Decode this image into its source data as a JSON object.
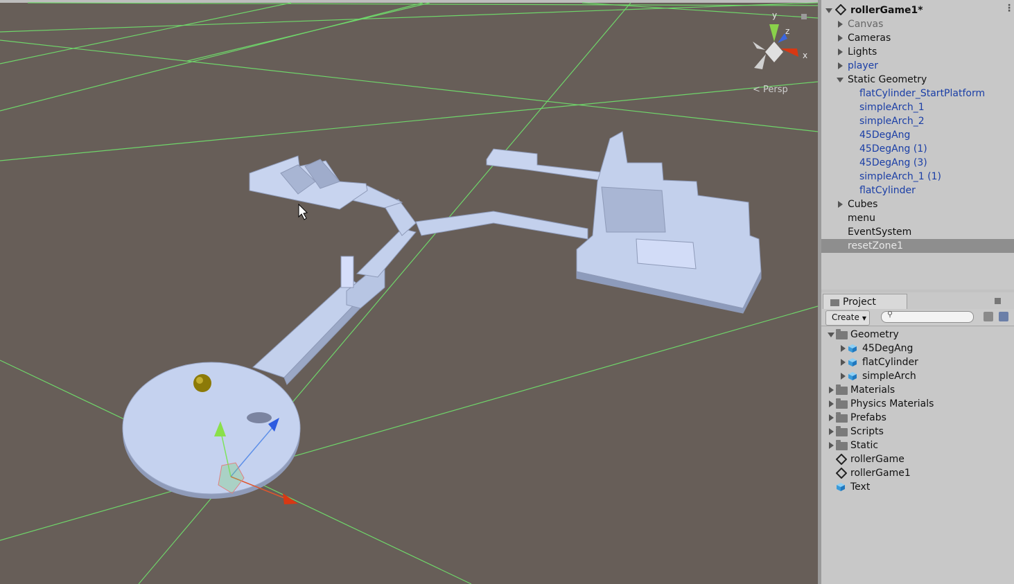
{
  "scene": {
    "persp_label": "Persp",
    "gizmo_axis_labels": {
      "x": "x",
      "y": "y",
      "z": "z"
    }
  },
  "hierarchy": {
    "scene_name": "rollerGame1*",
    "items": [
      {
        "label": "Canvas",
        "style": "grey"
      },
      {
        "label": "Cameras",
        "style": "normal"
      },
      {
        "label": "Lights",
        "style": "normal"
      },
      {
        "label": "player",
        "style": "blue"
      },
      {
        "label": "Static Geometry",
        "style": "normal"
      },
      {
        "label": "flatCylinder_StartPlatform",
        "style": "blue"
      },
      {
        "label": "simpleArch_1",
        "style": "blue"
      },
      {
        "label": "simpleArch_2",
        "style": "blue"
      },
      {
        "label": "45DegAng",
        "style": "blue"
      },
      {
        "label": "45DegAng (1)",
        "style": "blue"
      },
      {
        "label": "45DegAng (3)",
        "style": "blue"
      },
      {
        "label": "simpleArch_1 (1)",
        "style": "blue"
      },
      {
        "label": "flatCylinder",
        "style": "blue"
      },
      {
        "label": "Cubes",
        "style": "normal"
      },
      {
        "label": "menu",
        "style": "normal"
      },
      {
        "label": "EventSystem",
        "style": "normal"
      },
      {
        "label": "resetZone1",
        "style": "selected"
      }
    ]
  },
  "project": {
    "tab_label": "Project",
    "create_label": "Create",
    "items": [
      {
        "label": "Geometry",
        "icon": "folder-icon"
      },
      {
        "label": "45DegAng",
        "icon": "prefab-icon"
      },
      {
        "label": "flatCylinder",
        "icon": "prefab-icon"
      },
      {
        "label": "simpleArch",
        "icon": "prefab-icon"
      },
      {
        "label": "Materials",
        "icon": "folder-icon"
      },
      {
        "label": "Physics Materials",
        "icon": "folder-icon"
      },
      {
        "label": "Prefabs",
        "icon": "folder-icon"
      },
      {
        "label": "Scripts",
        "icon": "folder-icon"
      },
      {
        "label": "Static",
        "icon": "folder-icon"
      },
      {
        "label": "rollerGame",
        "icon": "unity-scene-icon"
      },
      {
        "label": "rollerGame1",
        "icon": "unity-scene-icon"
      },
      {
        "label": "Text",
        "icon": "prefab-icon"
      }
    ]
  }
}
